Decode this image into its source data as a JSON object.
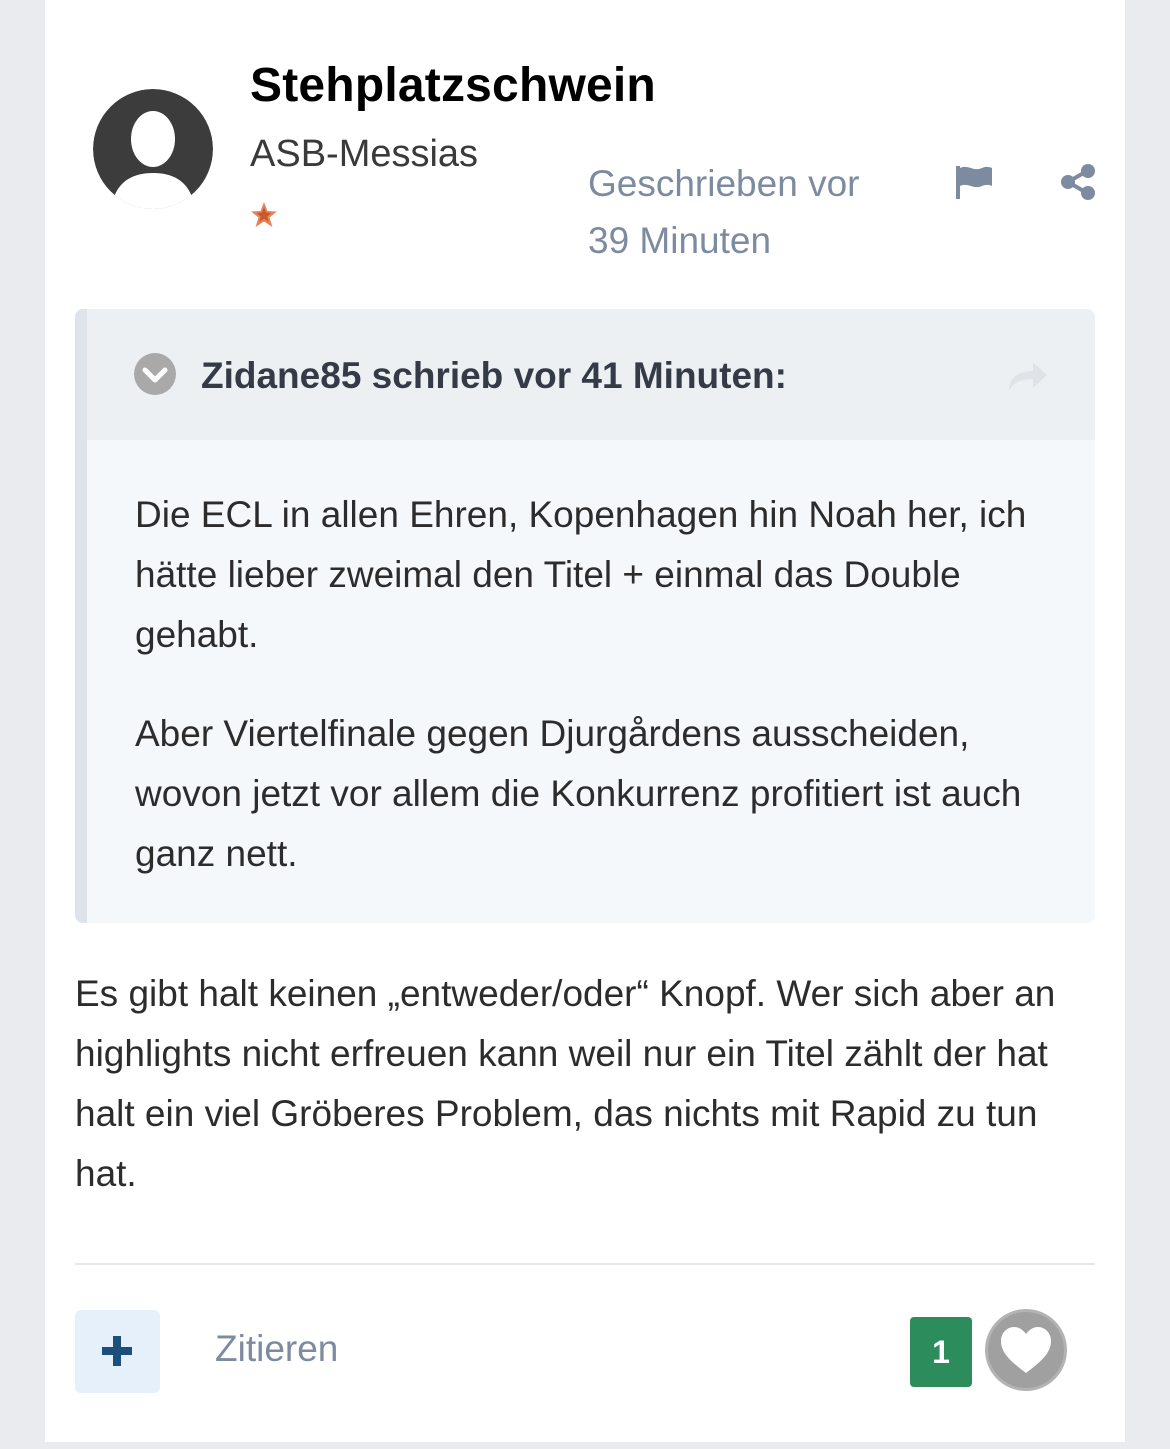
{
  "post": {
    "author": {
      "name": "Stehplatzschwein",
      "rank": "ASB-Messias"
    },
    "date": "Geschrieben vor 39 Minuten",
    "quote": {
      "citation": "Zidane85 schrieb vor 41 Minuten:",
      "paragraphs": [
        "Die ECL in allen Ehren, Kopenhagen hin Noah her, ich hätte lieber zweimal den Titel + einmal das Double gehabt.",
        "Aber Viertelfinale gegen Djurgårdens ausscheiden, wovon jetzt vor allem die Konkurrenz profitiert ist auch ganz nett."
      ]
    },
    "body": "Es gibt halt keinen „entweder/oder“ Knopf. Wer sich aber an highlights nicht erfreuen kann weil nur ein Titel zählt der hat halt ein viel Gröberes Problem, das nichts mit Rapid zu tun hat.",
    "actions": {
      "quote_label": "Zitieren",
      "reaction_count": "1"
    }
  },
  "colors": {
    "meta_text": "#7d8ba1",
    "reaction_green": "#2c8c5c",
    "quote_bg": "#f5f8fb",
    "quote_header_bg": "#edf0f3"
  },
  "icons": [
    "avatar-placeholder-icon",
    "rank-star-icon",
    "flag-icon",
    "share-icon",
    "chevron-down-circle-icon",
    "share-arrow-icon",
    "plus-icon",
    "heart-icon"
  ]
}
